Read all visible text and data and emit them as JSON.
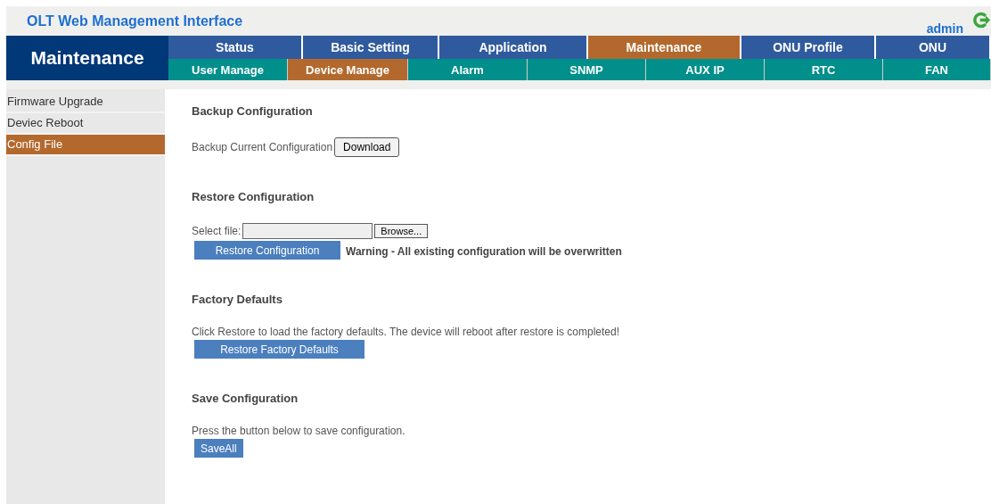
{
  "header": {
    "title": "OLT Web Management Interface",
    "user": "admin"
  },
  "section_title": "Maintenance",
  "tabs": [
    {
      "label": "Status",
      "selected": false
    },
    {
      "label": "Basic Setting",
      "selected": false
    },
    {
      "label": "Application",
      "selected": false
    },
    {
      "label": "Maintenance",
      "selected": true
    },
    {
      "label": "ONU Profile",
      "selected": false
    },
    {
      "label": "ONU",
      "selected": false
    }
  ],
  "subtabs": [
    {
      "label": "User Manage",
      "selected": false
    },
    {
      "label": "Device Manage",
      "selected": true
    },
    {
      "label": "Alarm",
      "selected": false
    },
    {
      "label": "SNMP",
      "selected": false
    },
    {
      "label": "AUX IP",
      "selected": false
    },
    {
      "label": "RTC",
      "selected": false
    },
    {
      "label": "FAN",
      "selected": false
    }
  ],
  "sidebar": {
    "items": [
      {
        "label": "Firmware Upgrade",
        "selected": false
      },
      {
        "label": "Deviec Reboot",
        "selected": false
      },
      {
        "label": "Config File",
        "selected": true
      }
    ]
  },
  "sections": [
    {
      "kind": "backup",
      "title": "Backup Configuration",
      "label": "Backup Current Configuration",
      "button": "Download"
    },
    {
      "kind": "restore",
      "title": "Restore Configuration",
      "label": "Select file:",
      "browse": "Browse...",
      "button": "Restore Configuration",
      "warning": "Warning - All existing configuration will be overwritten"
    },
    {
      "kind": "action",
      "title": "Factory Defaults",
      "text": "Click Restore to load the factory defaults. The device will reboot after restore is completed!",
      "button": "Restore Factory Defaults"
    },
    {
      "kind": "action",
      "title": "Save Configuration",
      "text": "Press the button below to save configuration.",
      "button": "SaveAll"
    }
  ]
}
